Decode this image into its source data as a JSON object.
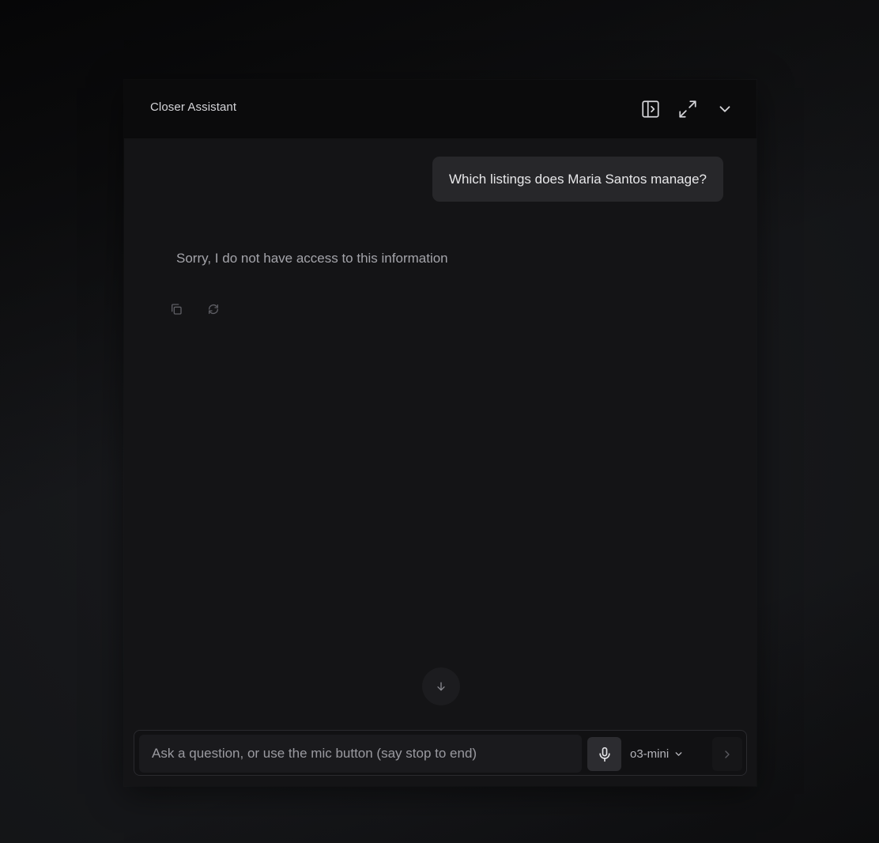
{
  "header": {
    "title": "Closer Assistant",
    "buttons": {
      "sidebar_icon": "panel-right-icon",
      "expand_icon": "expand-arrows-icon",
      "collapse_icon": "chevron-down-icon"
    }
  },
  "conversation": {
    "user_message": "Which listings does Maria Santos manage?",
    "assistant_message": "Sorry, I do not have access to this information",
    "actions": {
      "copy_icon": "copy-icon",
      "regenerate_icon": "refresh-icon"
    },
    "scroll_icon": "arrow-down-icon"
  },
  "composer": {
    "placeholder": "Ask a question, or use the mic button (say stop to end)",
    "value": "",
    "mic_icon": "microphone-icon",
    "model": "o3-mini",
    "send_icon": "chevron-right-icon"
  },
  "colors": {
    "panel_bg": "#141416",
    "header_bg": "#0b0b0c",
    "user_bubble_bg": "#27272a",
    "assistant_text": "#a4a4aa"
  }
}
